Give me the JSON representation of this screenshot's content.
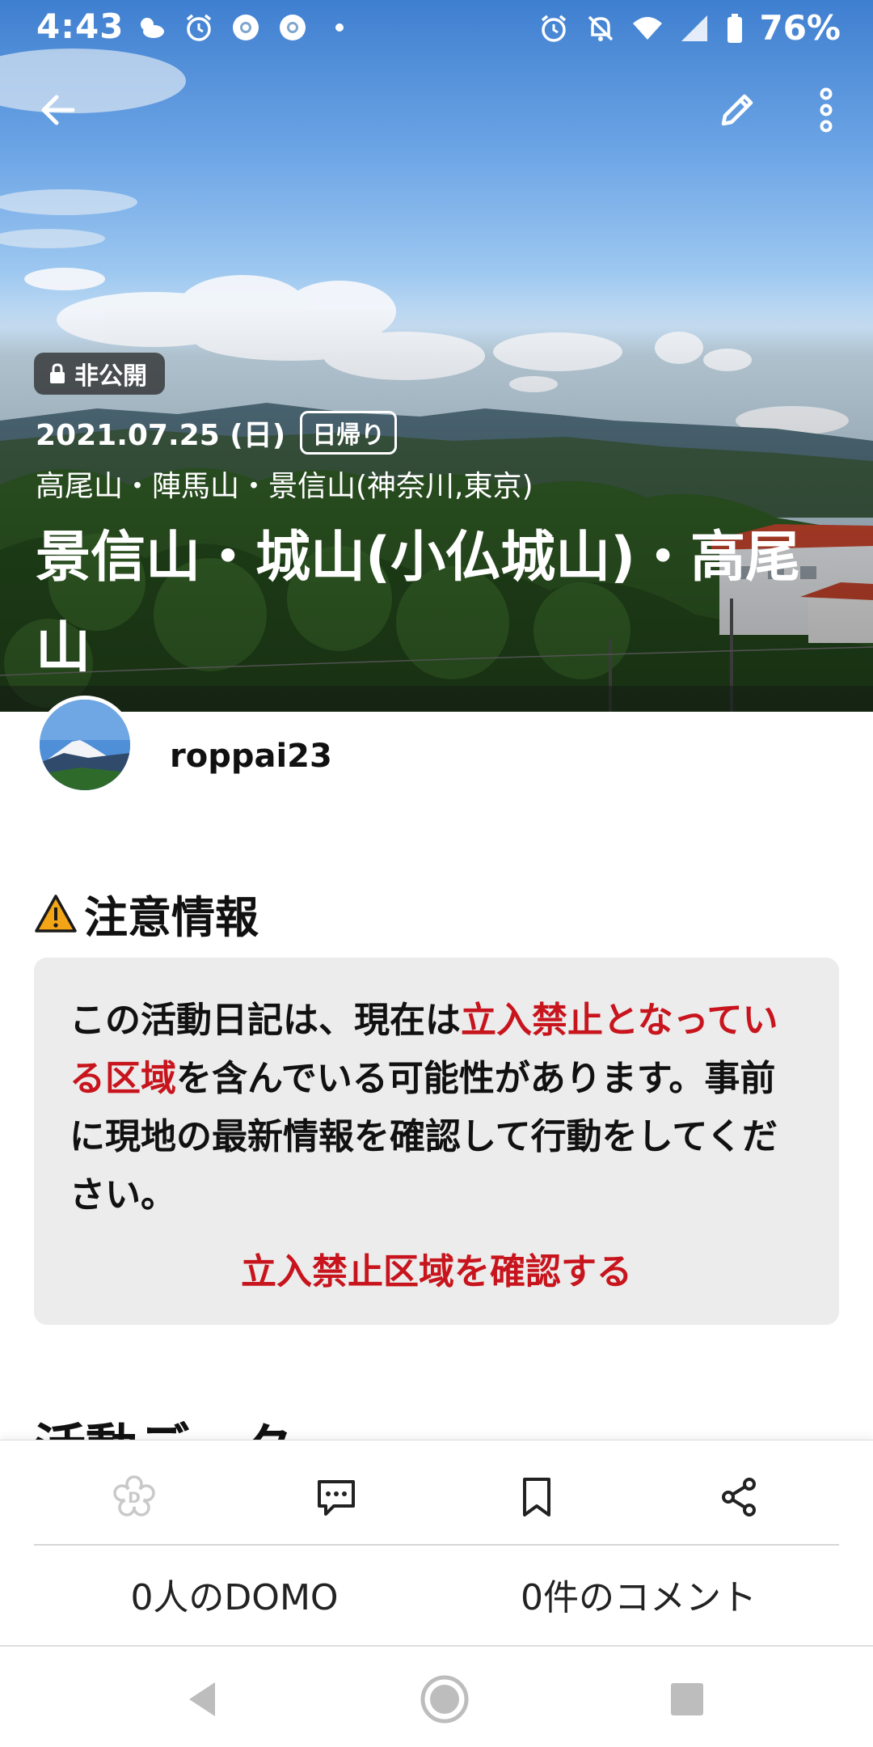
{
  "status_bar": {
    "time": "4:43",
    "battery": "76%",
    "left_icons": [
      "weather-icon",
      "alarm-icon",
      "chrome-icon",
      "chrome-icon",
      "dot-icon"
    ],
    "right_icons": [
      "alarm-icon",
      "bell-off-icon",
      "wifi-icon",
      "signal-icon",
      "battery-icon"
    ]
  },
  "hero": {
    "privacy_label": "非公開",
    "date": "2021.07.25 (日)",
    "trip_type": "日帰り",
    "area": "高尾山・陣馬山・景信山(神奈川,東京)",
    "title": "景信山・城山(小仏城山)・高尾山"
  },
  "user": {
    "name": "roppai23"
  },
  "caution": {
    "title": "注意情報",
    "body_1": "この活動日記は、現在は",
    "body_highlight": "立入禁止となっている区域",
    "body_2": "を含んでいる可能性があります。事前に現地の最新情報を確認して行動をしてください。",
    "link": "立入禁止区域を確認する"
  },
  "next_section_title": "活動データ",
  "actions": {
    "icons": [
      "domo-icon",
      "comment-icon",
      "bookmark-icon",
      "share-icon"
    ],
    "domo_count": "0人のDOMO",
    "comment_count": "0件のコメント"
  },
  "colors": {
    "accent_red": "#c8151d",
    "caution_bg": "#ececec",
    "warning_yellow": "#f2a516"
  }
}
